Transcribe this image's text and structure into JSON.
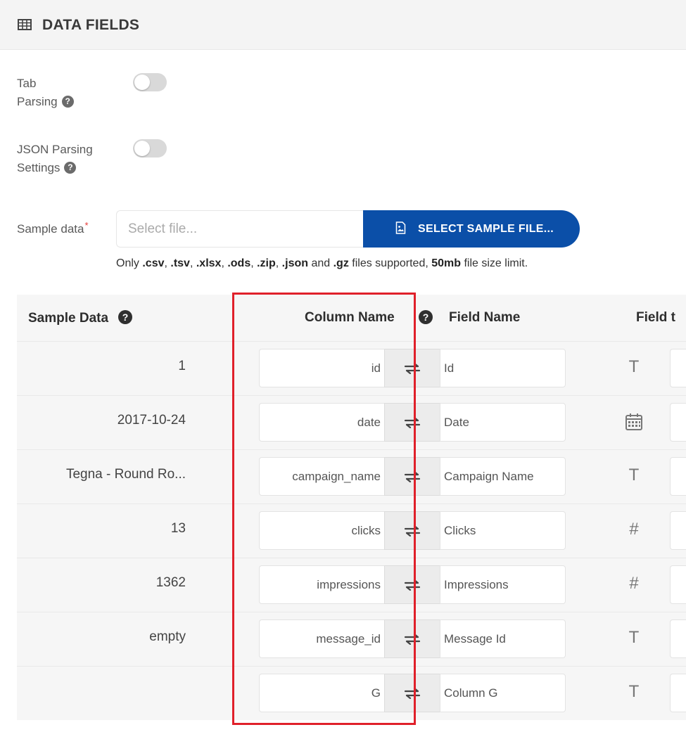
{
  "header": {
    "title": "DATA FIELDS",
    "icon": "table-icon"
  },
  "settings": {
    "tab_parsing": {
      "line1": "Tab",
      "line2": "Parsing",
      "help": "?",
      "enabled": false
    },
    "json_parsing": {
      "line1": "JSON Parsing",
      "line2": "Settings",
      "help": "?",
      "enabled": false
    }
  },
  "sample_data": {
    "label": "Sample data",
    "required_mark": "*",
    "placeholder": "Select file...",
    "button_label": "SELECT SAMPLE FILE...",
    "button_icon": "image-file-icon",
    "hint": {
      "prefix": "Only ",
      "ext1": ".csv",
      "sep1": ", ",
      "ext2": ".tsv",
      "sep2": ", ",
      "ext3": ".xlsx",
      "sep3": ", ",
      "ext4": ".ods",
      "sep4": ", ",
      "ext5": ".zip",
      "sep5": ", ",
      "ext6": ".json",
      "and": " and ",
      "ext7": ".gz",
      "middle": " files supported, ",
      "limit": "50mb",
      "suffix": " file size limit."
    }
  },
  "table": {
    "headers": {
      "sample_data": "Sample Data",
      "sample_data_help": "?",
      "column_name": "Column Name",
      "column_name_help": "?",
      "field_name": "Field Name",
      "field_type": "Field t"
    },
    "rows": [
      {
        "sample": "1",
        "column": "id",
        "field": "Id",
        "type_icon": "text-type-icon",
        "type_glyph": "T"
      },
      {
        "sample": "2017-10-24",
        "column": "date",
        "field": "Date",
        "type_icon": "calendar-icon",
        "type_glyph": ""
      },
      {
        "sample": "Tegna - Round Ro...",
        "column": "campaign_name",
        "field": "Campaign Name",
        "type_icon": "text-type-icon",
        "type_glyph": "T"
      },
      {
        "sample": "13",
        "column": "clicks",
        "field": "Clicks",
        "type_icon": "number-type-icon",
        "type_glyph": "#"
      },
      {
        "sample": "1362",
        "column": "impressions",
        "field": "Impressions",
        "type_icon": "number-type-icon",
        "type_glyph": "#"
      },
      {
        "sample": "empty",
        "column": "message_id",
        "field": "Message Id",
        "type_icon": "text-type-icon",
        "type_glyph": "T"
      },
      {
        "sample": "",
        "column": "G",
        "field": "Column G",
        "type_icon": "text-type-icon",
        "type_glyph": "T"
      }
    ]
  },
  "colors": {
    "accent": "#0b4fa8",
    "highlight": "#e0202a",
    "required": "#e53935",
    "header_bg": "#f4f4f4",
    "grid_bg": "#f6f6f6"
  }
}
